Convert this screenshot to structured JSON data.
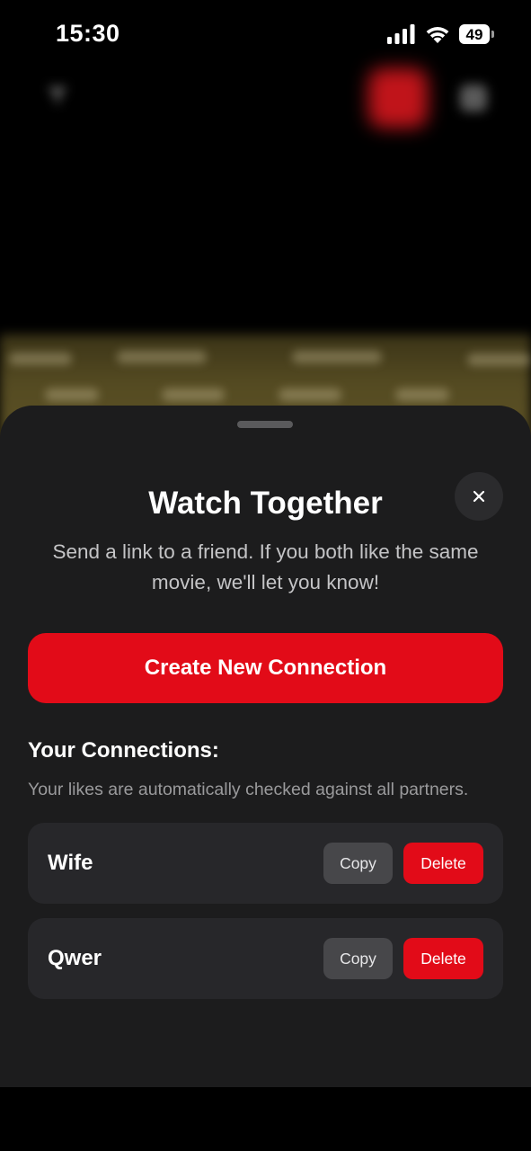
{
  "status_bar": {
    "time": "15:30",
    "battery": "49",
    "icons": [
      "signal-icon",
      "wifi-icon",
      "battery-icon"
    ]
  },
  "background": {
    "icons": [
      "filter-icon",
      "user-icon"
    ],
    "accent": "#c0141a"
  },
  "sheet": {
    "title": "Watch Together",
    "subtitle": "Send a link to a friend. If you both like the same movie, we'll let you know!",
    "close_icon": "close-icon",
    "create_button_label": "Create New Connection",
    "connections_heading": "Your Connections:",
    "connections_note": "Your likes are automatically checked against all partners.",
    "connections": [
      {
        "name": "Wife",
        "copy_label": "Copy",
        "delete_label": "Delete"
      },
      {
        "name": "Qwer",
        "copy_label": "Copy",
        "delete_label": "Delete"
      }
    ]
  },
  "colors": {
    "accent_red": "#e20b18",
    "sheet_background": "#1c1c1d",
    "row_background": "#27272a",
    "copy_button": "#47474a"
  }
}
